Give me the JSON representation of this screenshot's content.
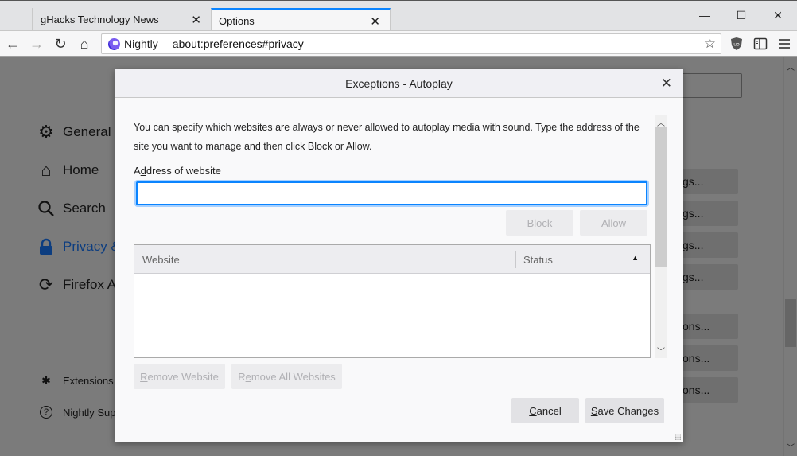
{
  "browser": {
    "tabs": [
      {
        "title": "gHacks Technology News",
        "active": false
      },
      {
        "title": "Options",
        "active": true
      }
    ],
    "window_controls": {
      "minimize": "—",
      "maximize": "☐",
      "close": "✕"
    },
    "nav": {
      "back_icon": "←",
      "forward_icon": "→",
      "reload_icon": "↻",
      "home_icon": "⌂",
      "identity_label": "Nightly",
      "url": "about:preferences#privacy",
      "bookmark_icon": "☆"
    },
    "accent_color": "#0a84ff"
  },
  "prefs": {
    "sidebar": [
      {
        "label": "General",
        "icon": "⚙",
        "selected": false
      },
      {
        "label": "Home",
        "icon": "⌂",
        "selected": false
      },
      {
        "label": "Search",
        "icon": "⌕",
        "selected": false
      },
      {
        "label": "Privacy &",
        "icon": "🔒",
        "selected": true
      },
      {
        "label": "Firefox Ac",
        "icon": "⟳",
        "selected": false
      }
    ],
    "sidebar_footer": [
      {
        "label": "Extensions",
        "icon": "✱"
      },
      {
        "label": "Nightly Sup",
        "icon": "?"
      }
    ],
    "background_buttons": [
      "gs...",
      "gs...",
      "gs...",
      "gs...",
      "ons...",
      "ons...",
      "ons..."
    ]
  },
  "dialog": {
    "title": "Exceptions - Autoplay",
    "close_icon": "✕",
    "description": "You can specify which websites are always or never allowed to autoplay media with sound. Type the address of the site you want to manage and then click Block or Allow.",
    "address_label_prefix": "A",
    "address_label_access": "d",
    "address_label_rest": "dress of website",
    "address_value": "",
    "address_placeholder": "",
    "block_access": "B",
    "block_rest": "lock",
    "allow_access": "A",
    "allow_rest": "llow",
    "table": {
      "columns": [
        "Website",
        "Status"
      ],
      "sort_indicator": "▲",
      "rows": []
    },
    "remove_website_access": "R",
    "remove_website_rest": "emove Website",
    "remove_all_prefix": "R",
    "remove_all_access": "e",
    "remove_all_rest": "move All Websites",
    "cancel_access": "C",
    "cancel_rest": "ancel",
    "save_access": "S",
    "save_rest": "ave Changes"
  }
}
